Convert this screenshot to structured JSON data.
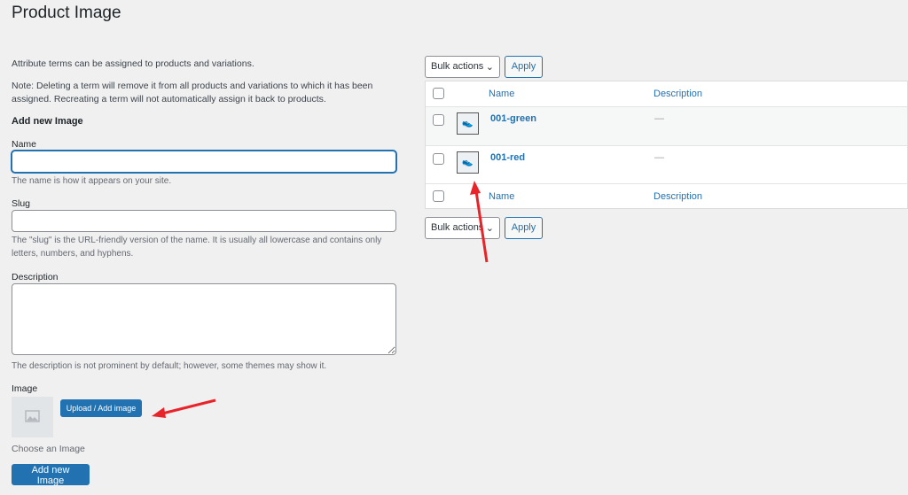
{
  "title": "Product Image",
  "form": {
    "intro": "Attribute terms can be assigned to products and variations.",
    "note": "Note: Deleting a term will remove it from all products and variations to which it has been assigned. Recreating a term will not automatically assign it back to products.",
    "heading": "Add new Image",
    "name_label": "Name",
    "name_value": "",
    "name_help": "The name is how it appears on your site.",
    "slug_label": "Slug",
    "slug_value": "",
    "slug_help": "The \"slug\" is the URL-friendly version of the name. It is usually all lowercase and contains only letters, numbers, and hyphens.",
    "description_label": "Description",
    "description_value": "",
    "description_help": "The description is not prominent by default; however, some themes may show it.",
    "image_label": "Image",
    "upload_button": "Upload / Add image",
    "choose_text": "Choose an Image",
    "submit_button": "Add new Image"
  },
  "table": {
    "bulk_actions": "Bulk actions",
    "apply": "Apply",
    "columns": [
      "Name",
      "Description"
    ],
    "rows": [
      {
        "name": "001-green",
        "description": "—"
      },
      {
        "name": "001-red",
        "description": "—"
      }
    ]
  },
  "colors": {
    "accent": "#2271b1",
    "annotation_arrow": "#e8242b"
  }
}
